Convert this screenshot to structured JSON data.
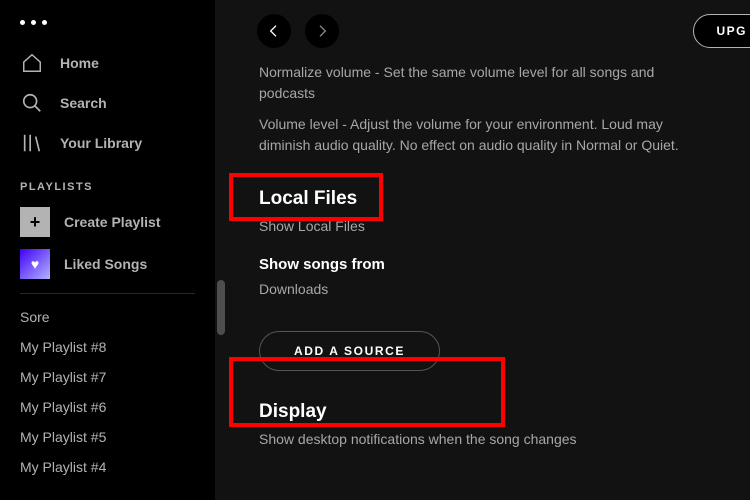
{
  "sidebar": {
    "nav": {
      "home": "Home",
      "search": "Search",
      "library": "Your Library"
    },
    "playlists_label": "PLAYLISTS",
    "create": "Create Playlist",
    "liked": "Liked Songs",
    "sore": "Sore",
    "items": [
      "My Playlist #8",
      "My Playlist #7",
      "My Playlist #6",
      "My Playlist #5",
      "My Playlist #4"
    ]
  },
  "topbar": {
    "upgrade": "UPG"
  },
  "settings": {
    "normalize": "Normalize volume - Set the same volume level for all songs and podcasts",
    "volume_level": "Volume level - Adjust the volume for your environment. Loud may diminish audio quality. No effect on audio quality in Normal or Quiet.",
    "local_files": "Local Files",
    "show_local_files": "Show Local Files",
    "show_songs_from": "Show songs from",
    "downloads": "Downloads",
    "add_source": "ADD A SOURCE",
    "display": "Display",
    "display_text": "Show desktop notifications when the song changes"
  }
}
